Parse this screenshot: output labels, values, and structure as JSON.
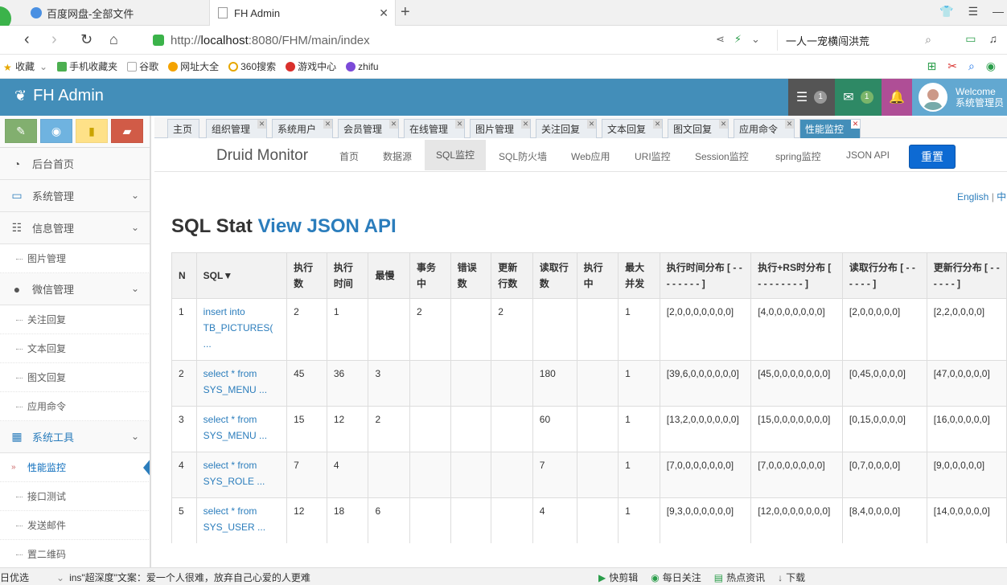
{
  "browser": {
    "tabs": [
      {
        "title": "百度网盘-全部文件"
      },
      {
        "title": "FH Admin"
      }
    ],
    "url_prefix": "http://",
    "url_host": "localhost",
    "url_path": ":8080/FHM/main/index",
    "search_text": "一人一宠横闯洪荒",
    "bookmarks": [
      "收藏",
      "手机收藏夹",
      "谷歌",
      "网址大全",
      "360搜索",
      "游戏中心",
      "zhifu"
    ]
  },
  "header": {
    "brand": "FH Admin",
    "tasks_count": "1",
    "mail_count": "1",
    "welcome_line1": "Welcome",
    "welcome_line2": "系统管理员"
  },
  "sidebar": {
    "items": [
      {
        "label": "后台首页",
        "icon": "dashboard-icon"
      },
      {
        "label": "系统管理",
        "icon": "desktop-icon"
      },
      {
        "label": "信息管理",
        "icon": "list-icon"
      },
      {
        "label": "图片管理"
      },
      {
        "label": "微信管理",
        "icon": "comments-icon"
      },
      {
        "label": "关注回复"
      },
      {
        "label": "文本回复"
      },
      {
        "label": "图文回复"
      },
      {
        "label": "应用命令"
      },
      {
        "label": "系统工具",
        "icon": "grid-icon"
      },
      {
        "label": "性能监控"
      },
      {
        "label": "接口测试"
      },
      {
        "label": "发送邮件"
      },
      {
        "label": "置二维码"
      }
    ]
  },
  "content_tabs": [
    "主页",
    "组织管理",
    "系统用户",
    "会员管理",
    "在线管理",
    "图片管理",
    "关注回复",
    "文本回复",
    "图文回复",
    "应用命令",
    "性能监控"
  ],
  "druid": {
    "brand": "Druid Monitor",
    "nav": [
      "首页",
      "数据源",
      "SQL监控",
      "SQL防火墙",
      "Web应用",
      "URI监控",
      "Session监控",
      "spring监控",
      "JSON API"
    ],
    "reset": "重置",
    "lang_en": "English",
    "lang_sep": " | ",
    "lang_cn": "中"
  },
  "stat": {
    "title": "SQL Stat",
    "link": "View JSON API"
  },
  "table": {
    "headers": [
      "N",
      "SQL▼",
      "执行数",
      "执行时间",
      "最慢",
      "事务中",
      "错误数",
      "更新行数",
      "读取行数",
      "执行中",
      "最大并发",
      "执行时间分布 [ - - - - - - - - ]",
      "执行+RS时分布 [ - - - - - - - - ]",
      "读取行分布 [ - - - - - - ]",
      "更新行分布 [ - - - - - - ]"
    ],
    "rows": [
      [
        "1",
        "insert into TB_PICTURES( ...",
        "2",
        "1",
        "",
        "2",
        "",
        "2",
        "",
        "",
        "1",
        "[2,0,0,0,0,0,0,0]",
        "[4,0,0,0,0,0,0,0]",
        "[2,0,0,0,0,0]",
        "[2,2,0,0,0,0]"
      ],
      [
        "2",
        "select * from SYS_MENU ...",
        "45",
        "36",
        "3",
        "",
        "",
        "",
        "180",
        "",
        "1",
        "[39,6,0,0,0,0,0,0]",
        "[45,0,0,0,0,0,0,0]",
        "[0,45,0,0,0,0]",
        "[47,0,0,0,0,0]"
      ],
      [
        "3",
        "select * from SYS_MENU ...",
        "15",
        "12",
        "2",
        "",
        "",
        "",
        "60",
        "",
        "1",
        "[13,2,0,0,0,0,0,0]",
        "[15,0,0,0,0,0,0,0]",
        "[0,15,0,0,0,0]",
        "[16,0,0,0,0,0]"
      ],
      [
        "4",
        "select * from SYS_ROLE ...",
        "7",
        "4",
        "",
        "",
        "",
        "",
        "7",
        "",
        "1",
        "[7,0,0,0,0,0,0,0]",
        "[7,0,0,0,0,0,0,0]",
        "[0,7,0,0,0,0]",
        "[9,0,0,0,0,0]"
      ],
      [
        "5",
        "select * from SYS_USER ...",
        "12",
        "18",
        "6",
        "",
        "",
        "",
        "4",
        "",
        "1",
        "[9,3,0,0,0,0,0,0]",
        "[12,0,0,0,0,0,0,0]",
        "[8,4,0,0,0,0]",
        "[14,0,0,0,0,0]"
      ]
    ]
  },
  "statusbar": {
    "left": "日优选",
    "news": "ins\"超深度\"文案：爱一个人很难，放弃自己心爱的人更难",
    "items": [
      "快剪辑",
      "每日关注",
      "热点资讯",
      "下载"
    ]
  }
}
